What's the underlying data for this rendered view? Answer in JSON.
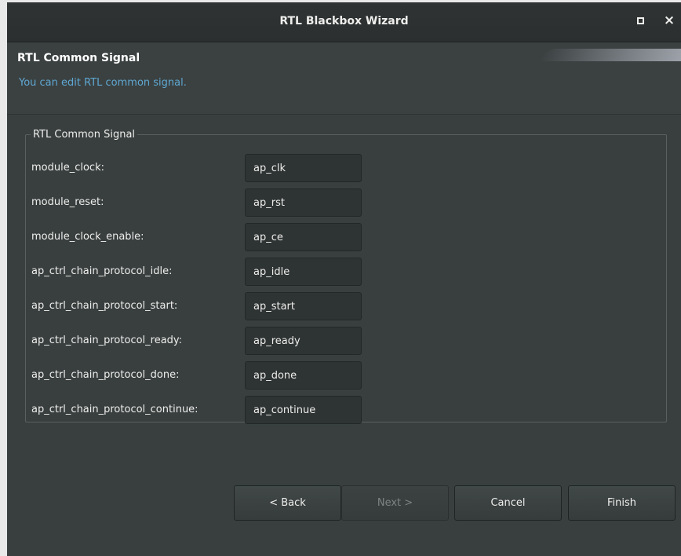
{
  "window": {
    "title": "RTL Blackbox Wizard",
    "maximize_icon": "maximize-icon",
    "close_glyph": "×"
  },
  "header": {
    "title": "RTL Common Signal",
    "description": "You can edit RTL common signal."
  },
  "group": {
    "title": "RTL Common Signal",
    "rows": [
      {
        "label": "module_clock:",
        "value": "ap_clk"
      },
      {
        "label": "module_reset:",
        "value": "ap_rst"
      },
      {
        "label": "module_clock_enable:",
        "value": "ap_ce"
      },
      {
        "label": "ap_ctrl_chain_protocol_idle:",
        "value": "ap_idle"
      },
      {
        "label": "ap_ctrl_chain_protocol_start:",
        "value": "ap_start"
      },
      {
        "label": "ap_ctrl_chain_protocol_ready:",
        "value": "ap_ready"
      },
      {
        "label": "ap_ctrl_chain_protocol_done:",
        "value": "ap_done"
      },
      {
        "label": "ap_ctrl_chain_protocol_continue:",
        "value": "ap_continue"
      }
    ]
  },
  "buttons": {
    "back": "< Back",
    "next": "Next >",
    "cancel": "Cancel",
    "finish": "Finish"
  },
  "colors": {
    "window_bg": "#393f3f",
    "accent_text": "#5fa8d3",
    "input_bg": "#2e3333"
  }
}
